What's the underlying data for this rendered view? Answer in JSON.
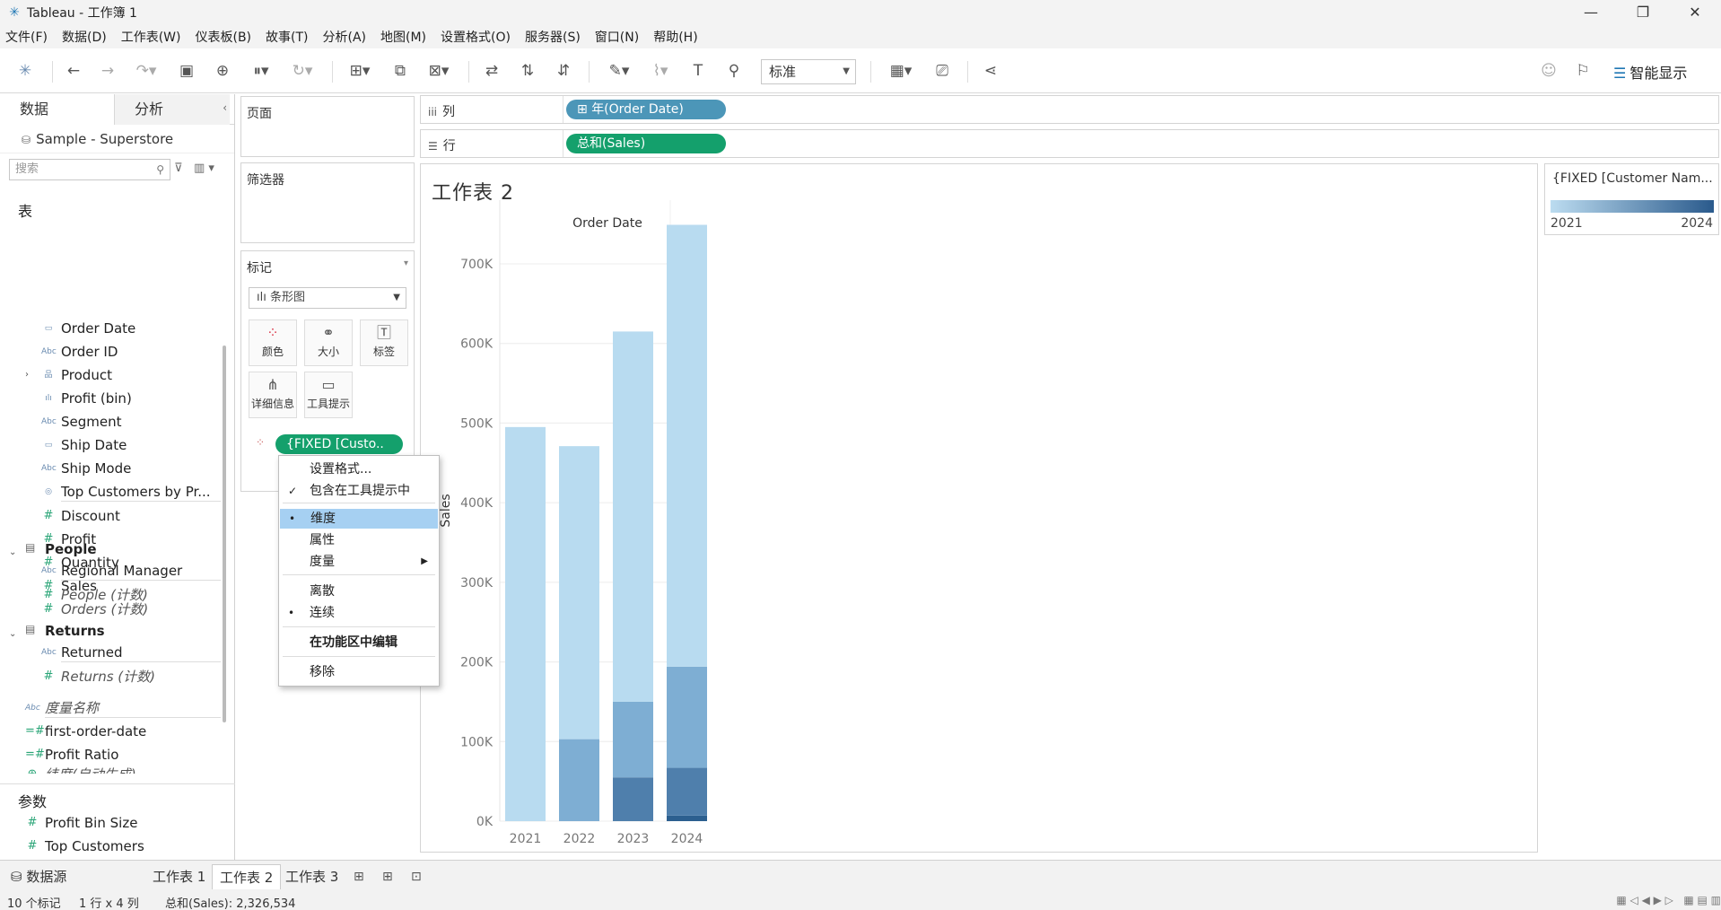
{
  "window": {
    "title": "Tableau - 工作簿 1",
    "min": "—",
    "max": "❐",
    "close": "✕"
  },
  "menu": [
    "文件(F)",
    "数据(D)",
    "工作表(W)",
    "仪表板(B)",
    "故事(T)",
    "分析(A)",
    "地图(M)",
    "设置格式(O)",
    "服务器(S)",
    "窗口(N)",
    "帮助(H)"
  ],
  "toolbar": {
    "fit": "标准",
    "smart_show": "智能显示"
  },
  "left_panel": {
    "tab_data": "数据",
    "tab_analysis": "分析",
    "datasource": "Sample - Superstore",
    "search_placeholder": "搜索",
    "tables_header": "表",
    "fields": [
      {
        "name": "Order Date",
        "icon": "calendar-icon",
        "glyph": "▭"
      },
      {
        "name": "Order ID",
        "icon": "string-icon",
        "glyph": "Abc"
      },
      {
        "name": "Product",
        "icon": "hierarchy-icon",
        "glyph": "品"
      },
      {
        "name": "Profit (bin)",
        "icon": "bin-icon",
        "glyph": "ılı"
      },
      {
        "name": "Segment",
        "icon": "string-icon",
        "glyph": "Abc"
      },
      {
        "name": "Ship Date",
        "icon": "calendar-icon",
        "glyph": "▭"
      },
      {
        "name": "Ship Mode",
        "icon": "string-icon",
        "glyph": "Abc"
      },
      {
        "name": "Top Customers by Pr...",
        "icon": "set-icon",
        "glyph": "◎"
      },
      {
        "name": "Discount",
        "icon": "measure-icon",
        "glyph": "#"
      },
      {
        "name": "Profit",
        "icon": "measure-icon",
        "glyph": "#"
      },
      {
        "name": "Quantity",
        "icon": "measure-icon",
        "glyph": "#"
      },
      {
        "name": "Sales",
        "icon": "measure-icon",
        "glyph": "#"
      },
      {
        "name": "Orders (计数)",
        "icon": "measure-icon",
        "glyph": "#"
      }
    ],
    "people": {
      "header": "People",
      "fields": [
        "Regional Manager",
        "People (计数)"
      ]
    },
    "returns": {
      "header": "Returns",
      "fields": [
        "Returned",
        "Returns (计数)"
      ]
    },
    "extra_fields": [
      "度量名称",
      "first-order-date",
      "Profit Ratio",
      "纬度(自动生成)"
    ],
    "params_header": "参数",
    "params": [
      "Profit Bin Size",
      "Top Customers"
    ]
  },
  "cards": {
    "pages": "页面",
    "filters": "筛选器",
    "marks": "标记",
    "mark_type": "条形图",
    "buttons": [
      {
        "label": "颜色",
        "icon": "color-icon"
      },
      {
        "label": "大小",
        "icon": "size-icon"
      },
      {
        "label": "标签",
        "icon": "label-icon"
      },
      {
        "label": "详细信息",
        "icon": "detail-icon"
      },
      {
        "label": "工具提示",
        "icon": "tooltip-icon"
      }
    ],
    "color_pill": "{FIXED [Custo..",
    "color_pill_full": "{FIXED [Custo.."
  },
  "shelves": {
    "columns_label": "列",
    "rows_label": "行",
    "columns_pill": "年(Order Date)",
    "rows_pill": "总和(Sales)"
  },
  "context_menu": {
    "items": [
      {
        "label": "设置格式...",
        "mark": ""
      },
      {
        "label": "包含在工具提示中",
        "mark": "✓"
      },
      {
        "label": "维度",
        "mark": "•",
        "highlighted": true
      },
      {
        "label": "属性",
        "mark": ""
      },
      {
        "label": "度量",
        "mark": "",
        "submenu": "▶"
      },
      {
        "label": "离散",
        "mark": ""
      },
      {
        "label": "连续",
        "mark": "•"
      },
      {
        "label": "在功能区中编辑",
        "mark": "",
        "bold": true
      },
      {
        "label": "移除",
        "mark": ""
      }
    ]
  },
  "view": {
    "sheet_title": "工作表 2"
  },
  "legend": {
    "title": "{FIXED [Customer Nam...",
    "min": "2021",
    "max": "2024",
    "color_low": "#bcdcf0",
    "color_high": "#2a5a8c"
  },
  "chart_data": {
    "type": "bar",
    "title": "",
    "top_axis_label": "Order Date",
    "ylabel": "Sales",
    "categories": [
      "2021",
      "2022",
      "2023",
      "2024"
    ],
    "ylim": [
      0,
      780000
    ],
    "yticks": [
      0,
      100000,
      200000,
      300000,
      400000,
      500000,
      600000,
      700000
    ],
    "ytick_labels": [
      "0K",
      "100K",
      "200K",
      "300K",
      "400K",
      "500K",
      "600K",
      "700K"
    ],
    "stacked": true,
    "series": [
      {
        "color": "#2c5f8f",
        "values": [
          0,
          0,
          0,
          7000
        ]
      },
      {
        "color": "#4f7fac",
        "values": [
          0,
          0,
          55000,
          60000
        ]
      },
      {
        "color": "#7eaed3",
        "values": [
          0,
          103000,
          95000,
          127000
        ]
      },
      {
        "color": "#b8dbf0",
        "values": [
          495000,
          368000,
          465000,
          555000
        ]
      }
    ]
  },
  "sheet_tabs": {
    "datasource": "数据源",
    "tabs": [
      "工作表 1",
      "工作表 2",
      "工作表 3"
    ],
    "active": 1
  },
  "status": {
    "marks": "10 个标记",
    "dims": "1 行 x 4 列",
    "sum": "总和(Sales): 2,326,534"
  }
}
